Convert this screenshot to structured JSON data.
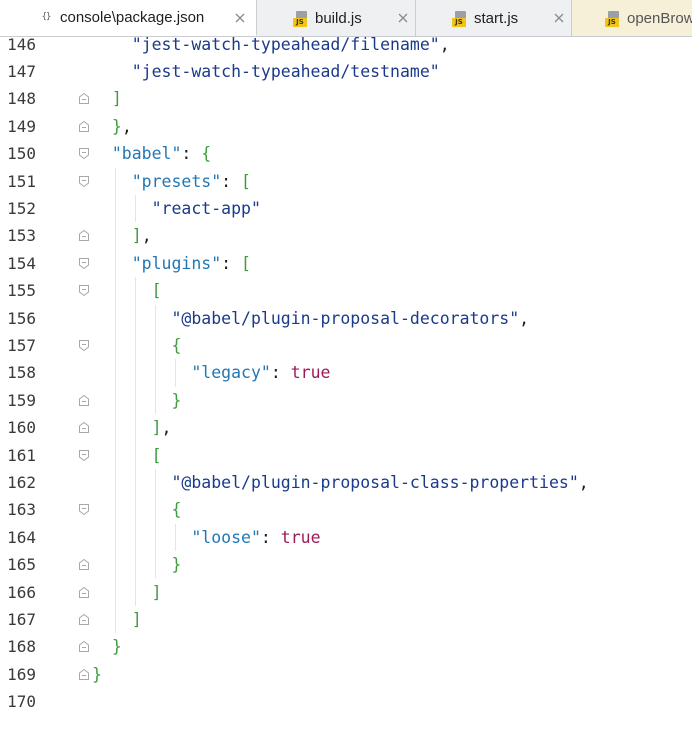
{
  "tabs": [
    {
      "label": "console\\package.json",
      "icon": "json-icon",
      "active": true
    },
    {
      "label": "build.js",
      "icon": "js-icon",
      "active": false
    },
    {
      "label": "start.js",
      "icon": "js-icon",
      "active": false
    },
    {
      "label": "openBrow",
      "icon": "js-icon",
      "active": false
    }
  ],
  "json_icon_text": "{}",
  "js_icon_text": "JS",
  "colors": {
    "property": "#2277b5",
    "string": "#1a3a8a",
    "punctuation": "#3e9c3e",
    "keyword": "#9b1b58",
    "line_number": "#3a3a3a"
  },
  "editor": {
    "lines": [
      {
        "num": "146",
        "fold": "none",
        "tokens": [
          [
            "    ",
            "op"
          ],
          [
            "\"jest-watch-typeahead/filename\"",
            "str"
          ],
          [
            ",",
            "op"
          ]
        ]
      },
      {
        "num": "147",
        "fold": "none",
        "tokens": [
          [
            "    ",
            "op"
          ],
          [
            "\"jest-watch-typeahead/testname\"",
            "str"
          ]
        ]
      },
      {
        "num": "148",
        "fold": "end",
        "tokens": [
          [
            "  ",
            "op"
          ],
          [
            "]",
            "punc"
          ]
        ]
      },
      {
        "num": "149",
        "fold": "end",
        "tokens": [
          [
            "  ",
            "op"
          ],
          [
            "}",
            "punc"
          ],
          [
            ",",
            "op"
          ]
        ]
      },
      {
        "num": "150",
        "fold": "start",
        "tokens": [
          [
            "  ",
            "op"
          ],
          [
            "\"babel\"",
            "prop"
          ],
          [
            ": ",
            "op"
          ],
          [
            "{",
            "punc"
          ]
        ]
      },
      {
        "num": "151",
        "fold": "start",
        "tokens": [
          [
            "    ",
            "op"
          ],
          [
            "\"presets\"",
            "prop"
          ],
          [
            ": ",
            "op"
          ],
          [
            "[",
            "punc"
          ]
        ]
      },
      {
        "num": "152",
        "fold": "none",
        "tokens": [
          [
            "      ",
            "op"
          ],
          [
            "\"react-app\"",
            "str"
          ]
        ]
      },
      {
        "num": "153",
        "fold": "end",
        "tokens": [
          [
            "    ",
            "op"
          ],
          [
            "]",
            "punc"
          ],
          [
            ",",
            "op"
          ]
        ]
      },
      {
        "num": "154",
        "fold": "start",
        "tokens": [
          [
            "    ",
            "op"
          ],
          [
            "\"plugins\"",
            "prop"
          ],
          [
            ": ",
            "op"
          ],
          [
            "[",
            "punc"
          ]
        ]
      },
      {
        "num": "155",
        "fold": "start",
        "tokens": [
          [
            "      ",
            "op"
          ],
          [
            "[",
            "punc"
          ]
        ]
      },
      {
        "num": "156",
        "fold": "none",
        "tokens": [
          [
            "        ",
            "op"
          ],
          [
            "\"@babel/plugin-proposal-decorators\"",
            "str"
          ],
          [
            ",",
            "op"
          ]
        ]
      },
      {
        "num": "157",
        "fold": "start",
        "tokens": [
          [
            "        ",
            "op"
          ],
          [
            "{",
            "punc"
          ]
        ]
      },
      {
        "num": "158",
        "fold": "none",
        "tokens": [
          [
            "          ",
            "op"
          ],
          [
            "\"legacy\"",
            "prop"
          ],
          [
            ": ",
            "op"
          ],
          [
            "true",
            "kw"
          ]
        ]
      },
      {
        "num": "159",
        "fold": "end",
        "tokens": [
          [
            "        ",
            "op"
          ],
          [
            "}",
            "punc"
          ]
        ]
      },
      {
        "num": "160",
        "fold": "end",
        "tokens": [
          [
            "      ",
            "op"
          ],
          [
            "]",
            "punc"
          ],
          [
            ",",
            "op"
          ]
        ]
      },
      {
        "num": "161",
        "fold": "start",
        "tokens": [
          [
            "      ",
            "op"
          ],
          [
            "[",
            "punc"
          ]
        ]
      },
      {
        "num": "162",
        "fold": "none",
        "tokens": [
          [
            "        ",
            "op"
          ],
          [
            "\"@babel/plugin-proposal-class-properties\"",
            "str"
          ],
          [
            ",",
            "op"
          ]
        ]
      },
      {
        "num": "163",
        "fold": "start",
        "tokens": [
          [
            "        ",
            "op"
          ],
          [
            "{",
            "punc"
          ]
        ]
      },
      {
        "num": "164",
        "fold": "none",
        "tokens": [
          [
            "          ",
            "op"
          ],
          [
            "\"loose\"",
            "prop"
          ],
          [
            ": ",
            "op"
          ],
          [
            "true",
            "kw"
          ]
        ]
      },
      {
        "num": "165",
        "fold": "end",
        "tokens": [
          [
            "        ",
            "op"
          ],
          [
            "}",
            "punc"
          ]
        ]
      },
      {
        "num": "166",
        "fold": "end",
        "tokens": [
          [
            "      ",
            "op"
          ],
          [
            "]",
            "punc"
          ]
        ]
      },
      {
        "num": "167",
        "fold": "end",
        "tokens": [
          [
            "    ",
            "op"
          ],
          [
            "]",
            "punc"
          ]
        ]
      },
      {
        "num": "168",
        "fold": "end",
        "tokens": [
          [
            "  ",
            "op"
          ],
          [
            "}",
            "punc"
          ]
        ]
      },
      {
        "num": "169",
        "fold": "end",
        "tokens": [
          [
            "}",
            "punc"
          ]
        ]
      },
      {
        "num": "170",
        "fold": "none",
        "tokens": []
      }
    ]
  }
}
